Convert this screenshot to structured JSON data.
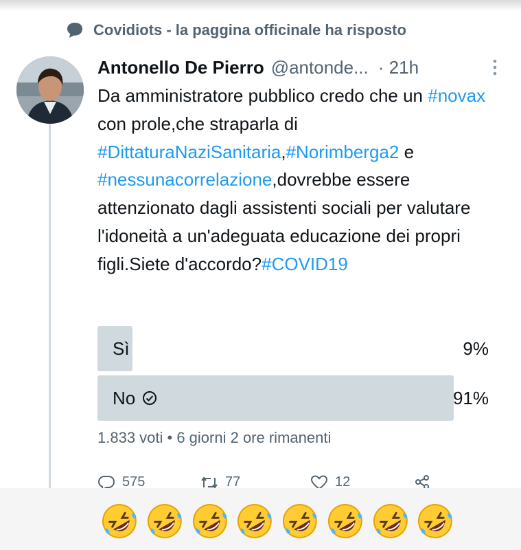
{
  "reply_context": {
    "icon": "speech-bubble-icon",
    "text": "Covidiots - la paggina officinale ha risposto"
  },
  "tweet": {
    "author_name": "Antonello De Pierro",
    "handle": "@antonde...",
    "time": "· 21h",
    "more_icon": "vertical-dots-icon",
    "text_segments": [
      {
        "text": "Da amministratore pubblico credo che un ",
        "tag": false
      },
      {
        "text": "#novax",
        "tag": true
      },
      {
        "text": " con prole,che straparla di ",
        "tag": false
      },
      {
        "text": "#DittaturaNaziSanitaria",
        "tag": true
      },
      {
        "text": ",",
        "tag": false
      },
      {
        "text": "#Norimberga2",
        "tag": true
      },
      {
        "text": " e ",
        "tag": false
      },
      {
        "text": "#nessunacorrelazione",
        "tag": true
      },
      {
        "text": ",dovrebbe essere attenzionato dagli assistenti sociali per valutare l'idoneità a un'adeguata educazione dei propri figli.Siete d'accordo?",
        "tag": false
      },
      {
        "text": "#COVID19",
        "tag": true
      }
    ]
  },
  "poll": {
    "options": [
      {
        "label": "Sì",
        "percent_text": "9%",
        "fraction": 0.09,
        "winner": false
      },
      {
        "label": "No",
        "percent_text": "91%",
        "fraction": 0.91,
        "winner": true
      }
    ],
    "meta": "1.833 voti • 6 giorni 2 ore rimanenti"
  },
  "actions": {
    "reply_count": "575",
    "retweet_count": "77",
    "like_count": "12"
  },
  "emoji_caption": {
    "emoji_name": "rolling-on-the-floor-laughing",
    "count": 8
  },
  "colors": {
    "link": "#1d9bf0",
    "secondary_text": "#536471",
    "poll_fill": "#cfd9de"
  }
}
